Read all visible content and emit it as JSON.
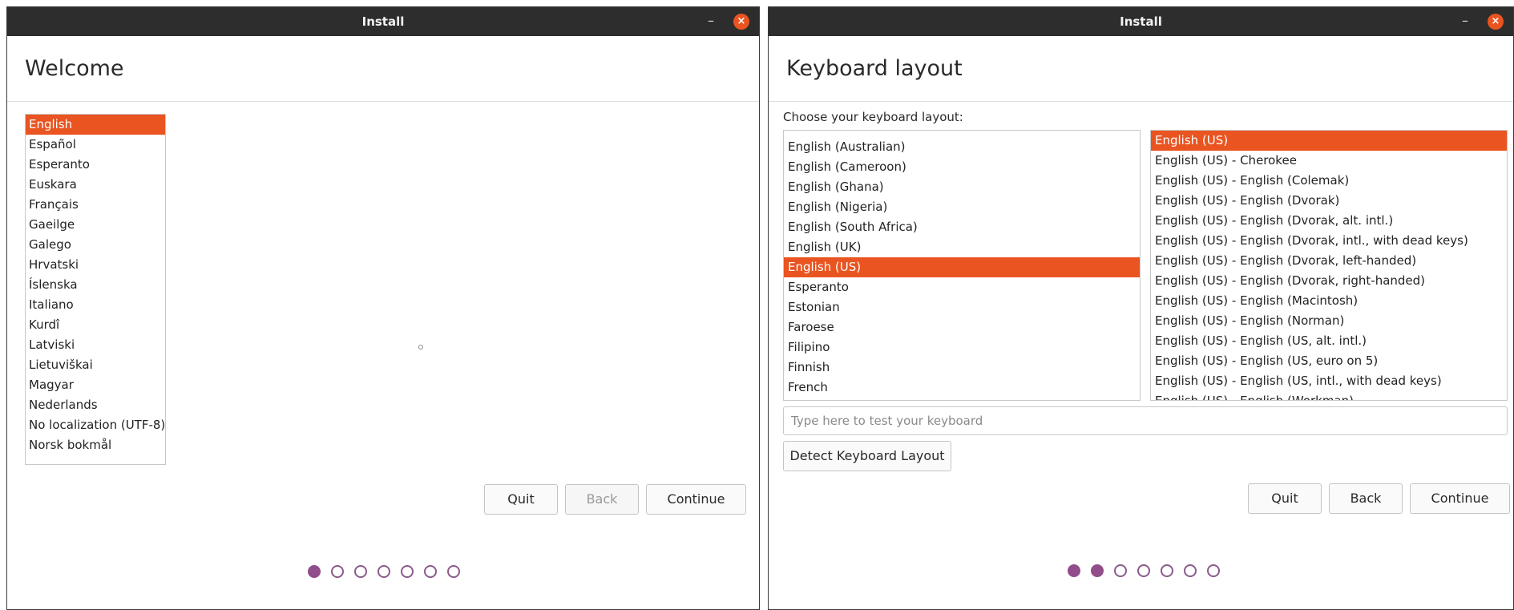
{
  "window1": {
    "title": "Install",
    "heading": "Welcome",
    "languages": [
      {
        "label": "English",
        "selected": true
      },
      {
        "label": "Español"
      },
      {
        "label": "Esperanto"
      },
      {
        "label": "Euskara"
      },
      {
        "label": "Français"
      },
      {
        "label": "Gaeilge"
      },
      {
        "label": "Galego"
      },
      {
        "label": "Hrvatski"
      },
      {
        "label": "Íslenska"
      },
      {
        "label": "Italiano"
      },
      {
        "label": "Kurdî"
      },
      {
        "label": "Latviski"
      },
      {
        "label": "Lietuviškai"
      },
      {
        "label": "Magyar"
      },
      {
        "label": "Nederlands"
      },
      {
        "label": "No localization (UTF-8)"
      },
      {
        "label": "Norsk bokmål"
      }
    ],
    "buttons": {
      "quit": "Quit",
      "back": "Back",
      "continue": "Continue"
    },
    "progress": {
      "total_steps": 7,
      "current_step": 1
    }
  },
  "window2": {
    "title": "Install",
    "heading": "Keyboard layout",
    "choose_label": "Choose your keyboard layout:",
    "layouts": [
      {
        "label": "English (Australian)"
      },
      {
        "label": "English (Cameroon)"
      },
      {
        "label": "English (Ghana)"
      },
      {
        "label": "English (Nigeria)"
      },
      {
        "label": "English (South Africa)"
      },
      {
        "label": "English (UK)"
      },
      {
        "label": "English (US)",
        "selected": true
      },
      {
        "label": "Esperanto"
      },
      {
        "label": "Estonian"
      },
      {
        "label": "Faroese"
      },
      {
        "label": "Filipino"
      },
      {
        "label": "Finnish"
      },
      {
        "label": "French"
      }
    ],
    "variants": [
      {
        "label": "English (US)",
        "selected": true
      },
      {
        "label": "English (US) - Cherokee"
      },
      {
        "label": "English (US) - English (Colemak)"
      },
      {
        "label": "English (US) - English (Dvorak)"
      },
      {
        "label": "English (US) - English (Dvorak, alt. intl.)"
      },
      {
        "label": "English (US) - English (Dvorak, intl., with dead keys)"
      },
      {
        "label": "English (US) - English (Dvorak, left-handed)"
      },
      {
        "label": "English (US) - English (Dvorak, right-handed)"
      },
      {
        "label": "English (US) - English (Macintosh)"
      },
      {
        "label": "English (US) - English (Norman)"
      },
      {
        "label": "English (US) - English (US, alt. intl.)"
      },
      {
        "label": "English (US) - English (US, euro on 5)"
      },
      {
        "label": "English (US) - English (US, intl., with dead keys)"
      },
      {
        "label": "English (US) - English (Workman)"
      }
    ],
    "test_placeholder": "Type here to test your keyboard",
    "detect_button": "Detect Keyboard Layout",
    "buttons": {
      "quit": "Quit",
      "back": "Back",
      "continue": "Continue"
    },
    "progress": {
      "total_steps": 7,
      "current_step": 2
    }
  },
  "colors": {
    "accent": "#e95420",
    "progress_dot": "#924d8b",
    "titlebar": "#2d2d2d"
  },
  "icons": {
    "minimize": "minimize-icon",
    "close": "close-icon"
  }
}
